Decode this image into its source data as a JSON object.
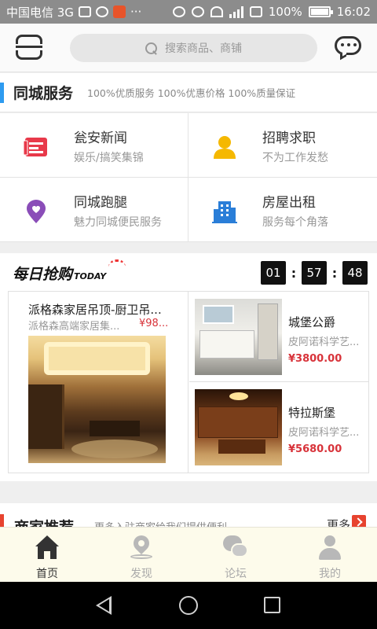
{
  "status_bar": {
    "carrier": "中国电信 3G",
    "battery": "100%",
    "time": "16:02"
  },
  "header": {
    "search_placeholder": "搜索商品、商铺",
    "icons": {
      "scan": "scan-icon",
      "search": "search-icon",
      "message": "message-icon"
    }
  },
  "services": {
    "title": "同城服务",
    "subtitle": "100%优质服务 100%优惠价格 100%质量保证",
    "accent": "#2e9bf0",
    "items": [
      {
        "title": "瓮安新闻",
        "desc": "娱乐/搞笑集锦",
        "icon": "news-icon",
        "color": "#e8394a"
      },
      {
        "title": "招聘求职",
        "desc": "不为工作发愁",
        "icon": "person-icon",
        "color": "#f5b800"
      },
      {
        "title": "同城跑腿",
        "desc": "魅力同城便民服务",
        "icon": "heart-pin-icon",
        "color": "#8a4db8"
      },
      {
        "title": "房屋出租",
        "desc": "服务每个角落",
        "icon": "building-icon",
        "color": "#2a7ed8"
      }
    ]
  },
  "flash_sale": {
    "logo_cn": "每日抢购",
    "logo_en": "TODAY",
    "countdown": {
      "hours": "01",
      "minutes": "57",
      "seconds": "48"
    },
    "products": [
      {
        "name": "派格森家居吊顶-厨卫吊...",
        "shop": "派格森高端家居集...",
        "price": "¥98..."
      },
      {
        "name": "城堡公爵",
        "shop": "皮阿诺科学艺...",
        "price": "¥3800.00"
      },
      {
        "name": "特拉斯堡",
        "shop": "皮阿诺科学艺...",
        "price": "¥5680.00"
      }
    ],
    "price_color": "#d8333a"
  },
  "merchant_rec": {
    "title": "商家推荐",
    "subtitle": "更多入驻商家给我们提供便利",
    "more": "更多",
    "accent": "#e7432f"
  },
  "tabbar": {
    "items": [
      {
        "label": "首页",
        "icon": "home-icon",
        "active": true
      },
      {
        "label": "发现",
        "icon": "location-icon",
        "active": false
      },
      {
        "label": "论坛",
        "icon": "chat-icon",
        "active": false
      },
      {
        "label": "我的",
        "icon": "user-icon",
        "active": false
      }
    ],
    "background": "#fdfbeb"
  },
  "navbar": {
    "icons": [
      "back-icon",
      "home-circle-icon",
      "recent-apps-icon"
    ]
  }
}
